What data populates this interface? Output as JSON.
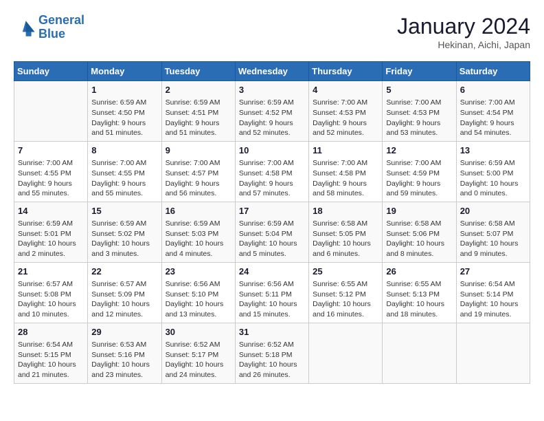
{
  "header": {
    "logo_line1": "General",
    "logo_line2": "Blue",
    "month": "January 2024",
    "location": "Hekinan, Aichi, Japan"
  },
  "weekdays": [
    "Sunday",
    "Monday",
    "Tuesday",
    "Wednesday",
    "Thursday",
    "Friday",
    "Saturday"
  ],
  "weeks": [
    [
      {
        "day": "",
        "info": ""
      },
      {
        "day": "1",
        "info": "Sunrise: 6:59 AM\nSunset: 4:50 PM\nDaylight: 9 hours\nand 51 minutes."
      },
      {
        "day": "2",
        "info": "Sunrise: 6:59 AM\nSunset: 4:51 PM\nDaylight: 9 hours\nand 51 minutes."
      },
      {
        "day": "3",
        "info": "Sunrise: 6:59 AM\nSunset: 4:52 PM\nDaylight: 9 hours\nand 52 minutes."
      },
      {
        "day": "4",
        "info": "Sunrise: 7:00 AM\nSunset: 4:53 PM\nDaylight: 9 hours\nand 52 minutes."
      },
      {
        "day": "5",
        "info": "Sunrise: 7:00 AM\nSunset: 4:53 PM\nDaylight: 9 hours\nand 53 minutes."
      },
      {
        "day": "6",
        "info": "Sunrise: 7:00 AM\nSunset: 4:54 PM\nDaylight: 9 hours\nand 54 minutes."
      }
    ],
    [
      {
        "day": "7",
        "info": "Sunrise: 7:00 AM\nSunset: 4:55 PM\nDaylight: 9 hours\nand 55 minutes."
      },
      {
        "day": "8",
        "info": "Sunrise: 7:00 AM\nSunset: 4:55 PM\nDaylight: 9 hours\nand 55 minutes."
      },
      {
        "day": "9",
        "info": "Sunrise: 7:00 AM\nSunset: 4:57 PM\nDaylight: 9 hours\nand 56 minutes."
      },
      {
        "day": "10",
        "info": "Sunrise: 7:00 AM\nSunset: 4:58 PM\nDaylight: 9 hours\nand 57 minutes."
      },
      {
        "day": "11",
        "info": "Sunrise: 7:00 AM\nSunset: 4:58 PM\nDaylight: 9 hours\nand 58 minutes."
      },
      {
        "day": "12",
        "info": "Sunrise: 7:00 AM\nSunset: 4:59 PM\nDaylight: 9 hours\nand 59 minutes."
      },
      {
        "day": "13",
        "info": "Sunrise: 6:59 AM\nSunset: 5:00 PM\nDaylight: 10 hours\nand 0 minutes."
      }
    ],
    [
      {
        "day": "14",
        "info": "Sunrise: 6:59 AM\nSunset: 5:01 PM\nDaylight: 10 hours\nand 2 minutes."
      },
      {
        "day": "15",
        "info": "Sunrise: 6:59 AM\nSunset: 5:02 PM\nDaylight: 10 hours\nand 3 minutes."
      },
      {
        "day": "16",
        "info": "Sunrise: 6:59 AM\nSunset: 5:03 PM\nDaylight: 10 hours\nand 4 minutes."
      },
      {
        "day": "17",
        "info": "Sunrise: 6:59 AM\nSunset: 5:04 PM\nDaylight: 10 hours\nand 5 minutes."
      },
      {
        "day": "18",
        "info": "Sunrise: 6:58 AM\nSunset: 5:05 PM\nDaylight: 10 hours\nand 6 minutes."
      },
      {
        "day": "19",
        "info": "Sunrise: 6:58 AM\nSunset: 5:06 PM\nDaylight: 10 hours\nand 8 minutes."
      },
      {
        "day": "20",
        "info": "Sunrise: 6:58 AM\nSunset: 5:07 PM\nDaylight: 10 hours\nand 9 minutes."
      }
    ],
    [
      {
        "day": "21",
        "info": "Sunrise: 6:57 AM\nSunset: 5:08 PM\nDaylight: 10 hours\nand 10 minutes."
      },
      {
        "day": "22",
        "info": "Sunrise: 6:57 AM\nSunset: 5:09 PM\nDaylight: 10 hours\nand 12 minutes."
      },
      {
        "day": "23",
        "info": "Sunrise: 6:56 AM\nSunset: 5:10 PM\nDaylight: 10 hours\nand 13 minutes."
      },
      {
        "day": "24",
        "info": "Sunrise: 6:56 AM\nSunset: 5:11 PM\nDaylight: 10 hours\nand 15 minutes."
      },
      {
        "day": "25",
        "info": "Sunrise: 6:55 AM\nSunset: 5:12 PM\nDaylight: 10 hours\nand 16 minutes."
      },
      {
        "day": "26",
        "info": "Sunrise: 6:55 AM\nSunset: 5:13 PM\nDaylight: 10 hours\nand 18 minutes."
      },
      {
        "day": "27",
        "info": "Sunrise: 6:54 AM\nSunset: 5:14 PM\nDaylight: 10 hours\nand 19 minutes."
      }
    ],
    [
      {
        "day": "28",
        "info": "Sunrise: 6:54 AM\nSunset: 5:15 PM\nDaylight: 10 hours\nand 21 minutes."
      },
      {
        "day": "29",
        "info": "Sunrise: 6:53 AM\nSunset: 5:16 PM\nDaylight: 10 hours\nand 23 minutes."
      },
      {
        "day": "30",
        "info": "Sunrise: 6:52 AM\nSunset: 5:17 PM\nDaylight: 10 hours\nand 24 minutes."
      },
      {
        "day": "31",
        "info": "Sunrise: 6:52 AM\nSunset: 5:18 PM\nDaylight: 10 hours\nand 26 minutes."
      },
      {
        "day": "",
        "info": ""
      },
      {
        "day": "",
        "info": ""
      },
      {
        "day": "",
        "info": ""
      }
    ]
  ]
}
